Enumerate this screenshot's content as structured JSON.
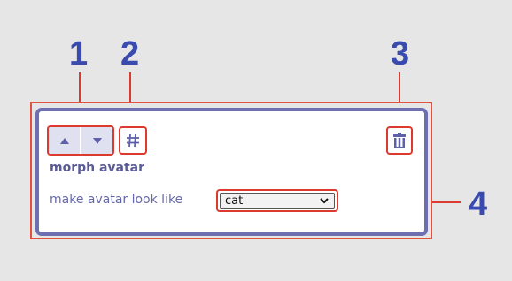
{
  "callouts": [
    "1",
    "2",
    "3",
    "4"
  ],
  "card": {
    "title": "morph avatar",
    "field_label": "make avatar look like",
    "select": {
      "value": "cat"
    }
  },
  "icons": {
    "move_up": "triangle-up-icon",
    "move_down": "triangle-down-icon",
    "shortcut": "hash-icon",
    "delete": "trash-icon",
    "select_chevron": "chevron-down-icon"
  },
  "colors": {
    "callout_number": "#3a4bb0",
    "highlight_red": "#dd3a2f",
    "card_border": "#6d6fb1",
    "background": "#e6e6e6"
  }
}
